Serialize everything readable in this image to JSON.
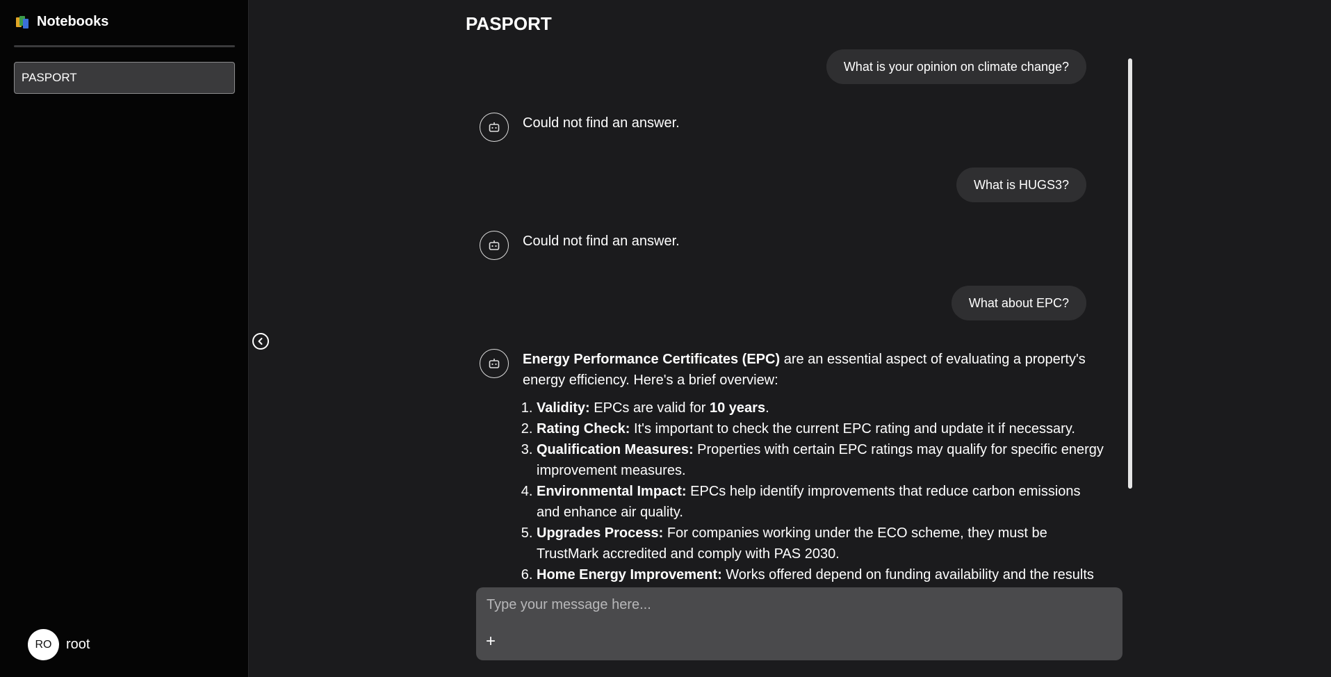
{
  "sidebar": {
    "title": "Notebooks",
    "notebooks": [
      {
        "label": "PASPORT"
      }
    ],
    "user": {
      "initials": "RO",
      "name": "root"
    }
  },
  "main": {
    "title": "PASPORT",
    "messages": [
      {
        "role": "user",
        "text": "What is your opinion on climate change?"
      },
      {
        "role": "assistant",
        "text": "Could not find an answer."
      },
      {
        "role": "user",
        "text": "What is HUGS3?"
      },
      {
        "role": "assistant",
        "text": "Could not find an answer."
      },
      {
        "role": "user",
        "text": "What about EPC?"
      },
      {
        "role": "assistant",
        "intro_bold": "Energy Performance Certificates (EPC)",
        "intro_rest": " are an essential aspect of evaluating a property's energy efficiency. Here's a brief overview:",
        "items": [
          {
            "bold": "Validity:",
            "text": " EPCs are valid for ",
            "bold2": "10 years",
            "text2": "."
          },
          {
            "bold": "Rating Check:",
            "text": " It's important to check the current EPC rating and update it if necessary."
          },
          {
            "bold": "Qualification Measures:",
            "text": " Properties with certain EPC ratings may qualify for specific energy improvement measures."
          },
          {
            "bold": "Environmental Impact:",
            "text": " EPCs help identify improvements that reduce carbon emissions and enhance air quality."
          },
          {
            "bold": "Upgrades Process:",
            "text": " For companies working under the ECO scheme, they must be TrustMark accredited and comply with PAS 2030."
          },
          {
            "bold": "Home Energy Improvement:",
            "text": " Works offered depend on funding availability and the results"
          }
        ]
      }
    ]
  },
  "composer": {
    "placeholder": "Type your message here...",
    "add_label": "+"
  },
  "colors": {
    "sidebar_bg": "#050505",
    "main_bg": "#1b1b1d",
    "bubble_bg": "#2f2f31",
    "composer_bg": "#4a4a4c"
  },
  "icons": {
    "bot": "robot-icon",
    "collapse": "chevron-left-circle-icon",
    "logo": "notebooks-logo-icon"
  }
}
